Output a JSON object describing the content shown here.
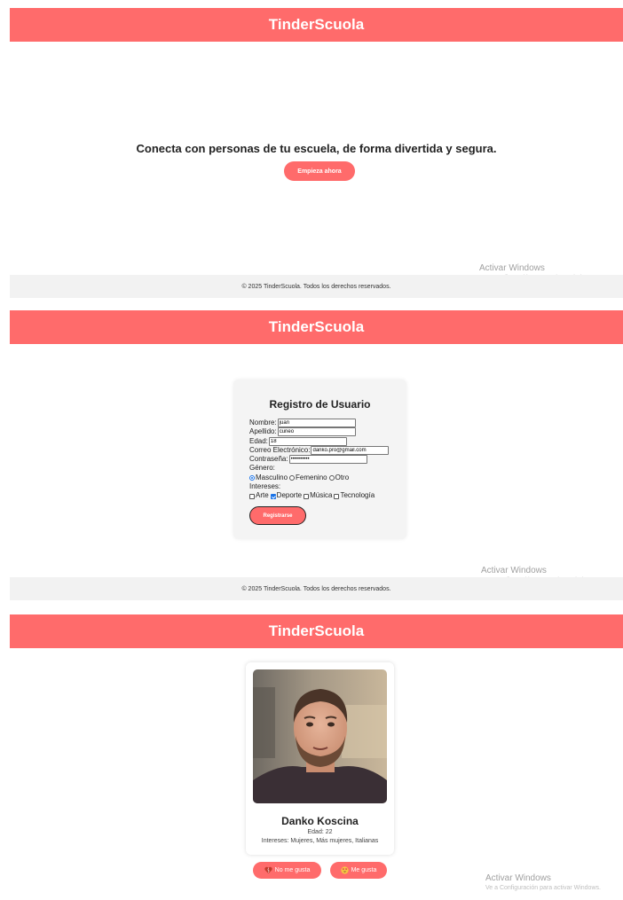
{
  "app": {
    "title": "TinderScuola",
    "footer_text": "© 2025 TinderScuola. Todos los derechos reservados."
  },
  "landing": {
    "tagline": "Conecta con personas de tu escuela, de forma divertida y segura.",
    "cta_label": "Empieza ahora"
  },
  "watermark": {
    "title": "Activar Windows",
    "subtitle": "Ve a Configuración para activar Windows."
  },
  "registration": {
    "title": "Registro de Usuario",
    "fields": {
      "nombre": {
        "label": "Nombre:",
        "value": "juan"
      },
      "apellido": {
        "label": "Apellido:",
        "value": "cuneo"
      },
      "edad": {
        "label": "Edad:",
        "value": "18"
      },
      "correo": {
        "label": "Correo Electrónico:",
        "value": "danko.pro@gmail.com"
      },
      "contrasena": {
        "label": "Contraseña:",
        "value": "••••••••••"
      }
    },
    "genero": {
      "label": "Género:",
      "options": [
        "Masculino",
        "Femenino",
        "Otro"
      ],
      "selected": "Masculino"
    },
    "intereses": {
      "label": "Intereses:",
      "options": [
        "Arte",
        "Deporte",
        "Música",
        "Tecnología"
      ],
      "checked": [
        "Deporte"
      ]
    },
    "submit_label": "Registrarse"
  },
  "profile": {
    "name": "Danko Koscina",
    "age_text": "Edad: 22",
    "interests_text": "Intereses: Mujeres, Más mujeres, Italianas",
    "dislike_label": "No me gusta",
    "like_label": "Me gusta"
  },
  "colors": {
    "brand": "#ff6b6b",
    "footer_bg": "#f2f2f2",
    "card_bg": "#f4f4f4"
  }
}
